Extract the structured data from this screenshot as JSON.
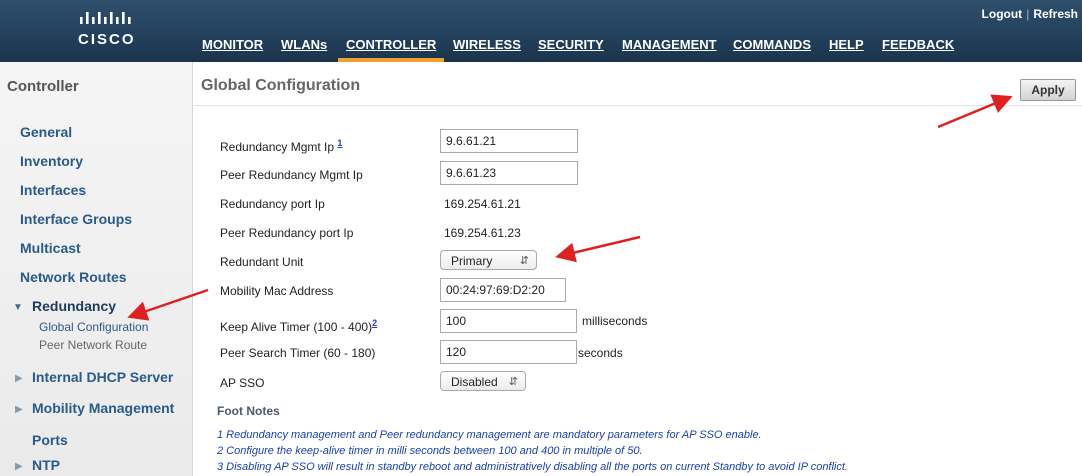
{
  "brand": {
    "logo_text": "cisco"
  },
  "top_links": {
    "logout": "Logout",
    "refresh": "Refresh"
  },
  "nav": {
    "items": [
      "MONITOR",
      "WLANs",
      "CONTROLLER",
      "WIRELESS",
      "SECURITY",
      "MANAGEMENT",
      "COMMANDS",
      "HELP",
      "FEEDBACK"
    ],
    "active": "CONTROLLER"
  },
  "sidebar": {
    "title": "Controller",
    "items": [
      "General",
      "Inventory",
      "Interfaces",
      "Interface Groups",
      "Multicast",
      "Network Routes",
      "Redundancy",
      "Internal DHCP Server",
      "Mobility Management",
      "Ports",
      "NTP"
    ],
    "active": "Redundancy",
    "subitems": [
      "Global Configuration",
      "Peer Network Route"
    ],
    "current_subitem": "Global Configuration"
  },
  "page": {
    "title": "Global Configuration",
    "apply_label": "Apply"
  },
  "form": {
    "redundancy_mgmt_ip": {
      "label": "Redundancy Mgmt Ip",
      "footnote_ref": "1",
      "value": "9.6.61.21"
    },
    "peer_redundancy_mgmt_ip": {
      "label": "Peer Redundancy Mgmt Ip",
      "value": "9.6.61.23"
    },
    "redundancy_port_ip": {
      "label": "Redundancy port Ip",
      "value": "169.254.61.21"
    },
    "peer_redundancy_port_ip": {
      "label": "Peer Redundancy port Ip",
      "value": "169.254.61.23"
    },
    "redundant_unit": {
      "label": "Redundant Unit",
      "value": "Primary"
    },
    "mobility_mac_address": {
      "label": "Mobility Mac Address",
      "value": "00:24:97:69:D2:20"
    },
    "keep_alive_timer": {
      "label": "Keep Alive Timer (100 - 400)",
      "footnote_ref": "2",
      "value": "100",
      "unit": "milliseconds"
    },
    "peer_search_timer": {
      "label": "Peer Search Timer (60 - 180)",
      "value": "120",
      "unit": "seconds"
    },
    "ap_sso": {
      "label": "AP SSO",
      "value": "Disabled"
    }
  },
  "footnotes": {
    "title": "Foot Notes",
    "notes": [
      "1 Redundancy management and Peer redundancy management are mandatory parameters for AP SSO enable.",
      "2 Configure the keep-alive timer in milli seconds between 100 and 400 in multiple of 50.",
      "3 Disabling AP SSO will result in standby reboot and administratively disabling all the ports on current Standby to avoid IP conflict."
    ]
  },
  "colors": {
    "header_bg": "#23415d",
    "active_tab": "#f0a030",
    "link_blue": "#2a5a8a",
    "annotation_red": "#e02020"
  }
}
